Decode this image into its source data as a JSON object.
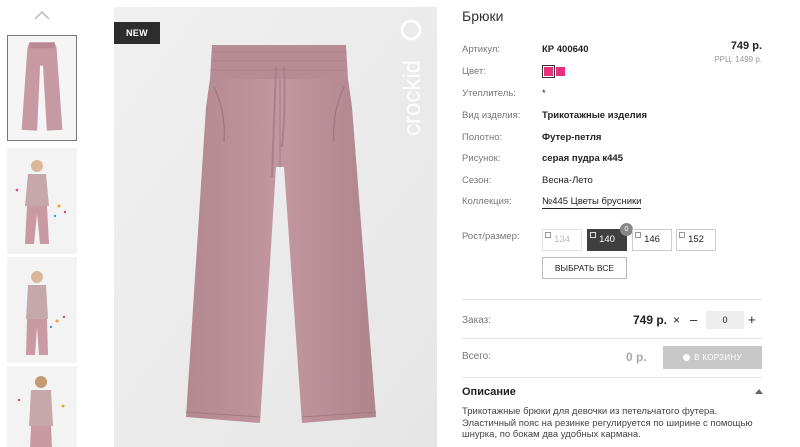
{
  "product": {
    "title": "Брюки",
    "badge": "NEW",
    "brand_logo_text": "crockid",
    "price": "749 р.",
    "rrc": "РРЦ: 1499 р."
  },
  "attributes": [
    {
      "label": "Артикул:",
      "value": "КР 400640"
    },
    {
      "label": "Цвет:",
      "value": ""
    },
    {
      "label": "Утеплитель:",
      "value": "*"
    },
    {
      "label": "Вид изделия:",
      "value": "Трикотажные изделия"
    },
    {
      "label": "Полотно:",
      "value": "Футер-петля"
    },
    {
      "label": "Рисунок:",
      "value": "серая пудра к445"
    },
    {
      "label": "Сезон:",
      "value": "Весна-Лето"
    },
    {
      "label": "Коллекция:",
      "value": "№445 Цветы брусники"
    }
  ],
  "colors": {
    "swatch": "#e4307e",
    "accent_dark": "#3f3f3f"
  },
  "sizes": {
    "label": "Рост/размер:",
    "options": [
      {
        "value": "134",
        "state": "disabled"
      },
      {
        "value": "140",
        "state": "selected"
      },
      {
        "value": "146",
        "state": "available"
      },
      {
        "value": "152",
        "state": "available"
      }
    ],
    "selected_qty": "0",
    "select_all": "ВЫБРАТЬ ВСЕ"
  },
  "order": {
    "label": "Заказ:",
    "price": "749 р.",
    "remove_icon": "×",
    "minus": "–",
    "qty": "0",
    "plus": "+"
  },
  "total": {
    "label": "Всего:",
    "value": "0 р.",
    "cart_button": "В КОРЗИНУ"
  },
  "description": {
    "title": "Описание",
    "text": "Трикотажные брюки для девочки из петельчатого футера. Эластичный пояс на резинке регулируется по ширине с помощью шнурка, по бокам два удобных кармана."
  }
}
